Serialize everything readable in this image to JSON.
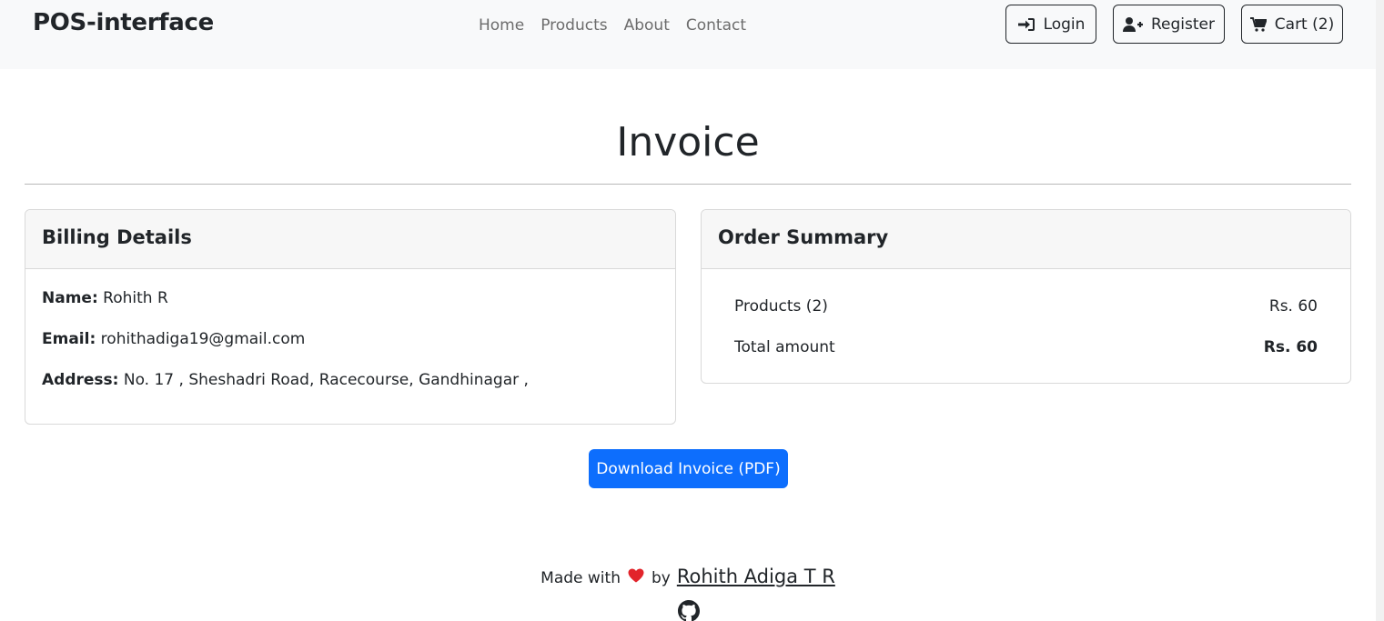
{
  "navbar": {
    "brand": "POS-interface",
    "links": [
      "Home",
      "Products",
      "About",
      "Contact"
    ],
    "login_label": "Login",
    "register_label": "Register",
    "cart_label": "Cart (2)"
  },
  "page": {
    "title": "Invoice"
  },
  "billing": {
    "header": "Billing Details",
    "name_label": "Name:",
    "name_value": "Rohith R",
    "email_label": "Email:",
    "email_value": "rohithadiga19@gmail.com",
    "address_label": "Address:",
    "address_value": "No. 17 , Sheshadri Road, Racecourse, Gandhinagar ,"
  },
  "summary": {
    "header": "Order Summary",
    "products_label": "Products (2)",
    "products_value": "Rs. 60",
    "total_label": "Total amount",
    "total_value": "Rs. 60"
  },
  "actions": {
    "download_label": "Download Invoice (PDF)"
  },
  "footer": {
    "made_with": "Made with",
    "by": "by",
    "author": "Rohith Adiga T R"
  },
  "icons": {
    "login": "sign-in-icon",
    "register": "user-plus-icon",
    "cart": "shopping-cart-icon",
    "heart": "heart-icon",
    "github": "github-icon"
  },
  "colors": {
    "navbar_bg": "#f8f9fa",
    "primary": "#0d6efd",
    "heart": "#e2242b"
  }
}
